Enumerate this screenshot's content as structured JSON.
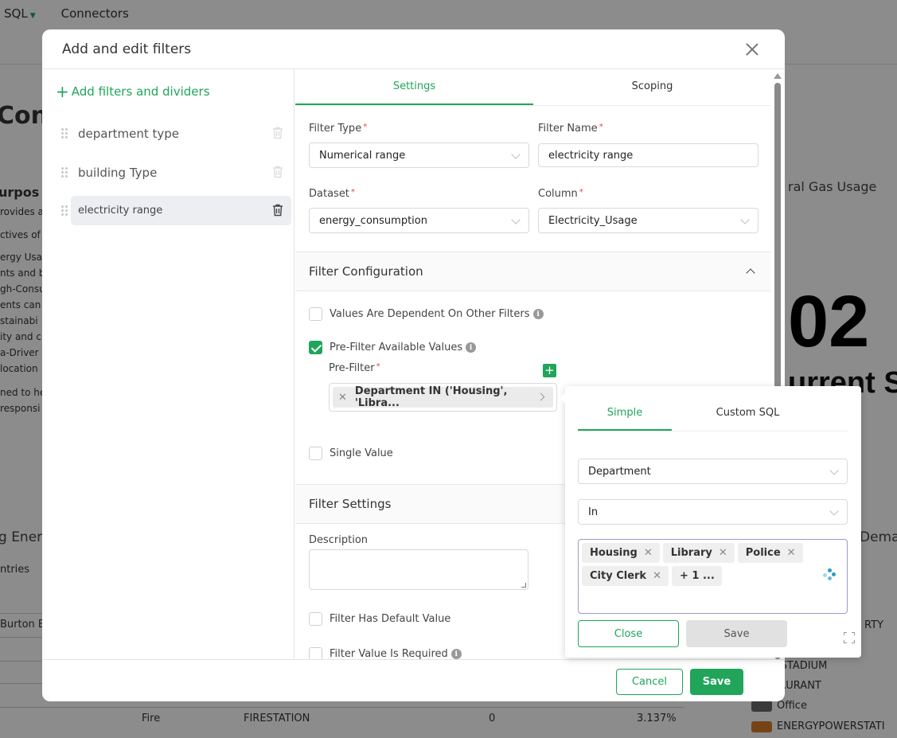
{
  "background": {
    "nav": {
      "sql": "SQL",
      "connectors": "Connectors"
    },
    "title_fragment": "Cons",
    "purpose_heading": "urpos",
    "text_lines": [
      "rovides a",
      "ctives of",
      "ergy Usa",
      "nts and b",
      "gh-Consu",
      "ents can",
      "stainabi",
      "ity and c",
      "a-Driver",
      "location",
      "ned to he",
      "responsi"
    ],
    "card_natural_gas": "ral Gas Usage",
    "big_number": "02",
    "current_label": "urrent Se",
    "section_energy": "g Ener",
    "entries_label": "ntries",
    "demand_label": "Dema",
    "burton_label": "Burton E",
    "table_row": {
      "department": "Fire",
      "type": "FIRESTATION",
      "value": "0",
      "percent": "3.137%"
    },
    "legend": [
      {
        "label": "RTY",
        "color": ""
      },
      {
        "label": "YM_STADIUM",
        "color": ""
      },
      {
        "label": "ESTAURANT",
        "color": ""
      },
      {
        "label": "Office",
        "color": "#6b6b6b"
      },
      {
        "label": "ENERGYPOWERSTATI",
        "color": "#b05a1c"
      }
    ]
  },
  "modal": {
    "title": "Add and edit filters",
    "add_filters_label": "Add filters and dividers",
    "filters": [
      {
        "name": "department type",
        "active": false
      },
      {
        "name": "building Type",
        "active": false
      },
      {
        "name": "electricity range",
        "active": true
      }
    ],
    "tabs": {
      "settings": "Settings",
      "scoping": "Scoping"
    },
    "fields": {
      "filter_type": {
        "label": "Filter Type",
        "value": "Numerical range"
      },
      "filter_name": {
        "label": "Filter Name",
        "value": "electricity range"
      },
      "dataset": {
        "label": "Dataset",
        "value": "energy_consumption"
      },
      "column": {
        "label": "Column",
        "value": "Electricity_Usage"
      },
      "required_marker": "*"
    },
    "filter_configuration": {
      "heading": "Filter Configuration",
      "values_dependent": {
        "label": "Values Are Dependent On Other Filters",
        "checked": false
      },
      "prefilter_available": {
        "label": "Pre-Filter Available Values",
        "checked": true
      },
      "prefilter_label": "Pre-Filter",
      "prefilter_chip": "Department IN ('Housing', 'Libra...",
      "single_value": {
        "label": "Single Value",
        "checked": false
      }
    },
    "filter_settings": {
      "heading": "Filter Settings",
      "description_label": "Description",
      "description_value": "",
      "has_default": {
        "label": "Filter Has Default Value",
        "checked": false
      },
      "is_required": {
        "label": "Filter Value Is Required",
        "checked": false
      }
    },
    "footer": {
      "cancel": "Cancel",
      "save": "Save"
    }
  },
  "popover": {
    "tabs": {
      "simple": "Simple",
      "custom_sql": "Custom SQL"
    },
    "column_value": "Department",
    "operator_value": "In",
    "tags": [
      "Housing",
      "Library",
      "Police",
      "City Clerk"
    ],
    "more_tag": "+ 1 ...",
    "close": "Close",
    "save": "Save"
  },
  "colors": {
    "accent": "#20a55b",
    "required": "#e04343"
  }
}
